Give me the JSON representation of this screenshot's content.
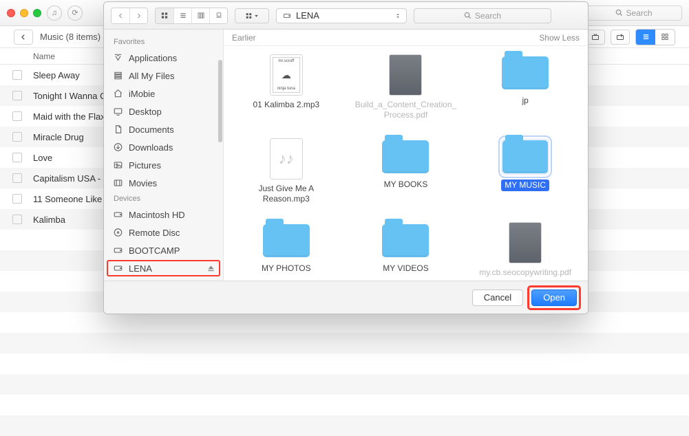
{
  "bg": {
    "search_placeholder": "Search",
    "breadcrumb": "Music (8 items)",
    "header_name": "Name",
    "songs": [
      "Sleep Away",
      "Tonight I Wanna C",
      "Maid with the Flax",
      "Miracle Drug",
      "Love",
      "Capitalism USA - T",
      "11 Someone Like",
      "Kalimba"
    ]
  },
  "dialog": {
    "path_device": "LENA",
    "search_placeholder": "Search",
    "section_label": "Earlier",
    "show_less": "Show Less",
    "cancel": "Cancel",
    "open": "Open",
    "sidebar": {
      "fav_head": "Favorites",
      "dev_head": "Devices",
      "favorites": [
        {
          "label": "Applications",
          "icon": "apps-icon"
        },
        {
          "label": "All My Files",
          "icon": "allfiles-icon"
        },
        {
          "label": "iMobie",
          "icon": "home-icon"
        },
        {
          "label": "Desktop",
          "icon": "desktop-icon"
        },
        {
          "label": "Documents",
          "icon": "documents-icon"
        },
        {
          "label": "Downloads",
          "icon": "downloads-icon"
        },
        {
          "label": "Pictures",
          "icon": "pictures-icon"
        },
        {
          "label": "Movies",
          "icon": "movies-icon"
        }
      ],
      "devices": [
        {
          "label": "Macintosh HD",
          "icon": "hdd-icon"
        },
        {
          "label": "Remote Disc",
          "icon": "disc-icon"
        },
        {
          "label": "BOOTCAMP",
          "icon": "hdd-icon"
        },
        {
          "label": "LENA",
          "icon": "hdd-icon",
          "selected": true,
          "ejectable": true
        }
      ]
    },
    "items": [
      {
        "name": "01 Kalimba 2.mp3",
        "kind": "image-doc"
      },
      {
        "name": "Build_a_Content_Creation_Process.pdf",
        "kind": "doc",
        "muted": true
      },
      {
        "name": "jp",
        "kind": "folder"
      },
      {
        "name": "Just Give Me A Reason.mp3",
        "kind": "audio-doc"
      },
      {
        "name": "MY BOOKS",
        "kind": "folder"
      },
      {
        "name": "MY MUSIC",
        "kind": "folder",
        "selected": true
      },
      {
        "name": "MY PHOTOS",
        "kind": "folder"
      },
      {
        "name": "MY VIDEOS",
        "kind": "folder"
      },
      {
        "name": "my.cb.seocopywriting.pdf",
        "kind": "doc",
        "muted": true
      }
    ]
  }
}
